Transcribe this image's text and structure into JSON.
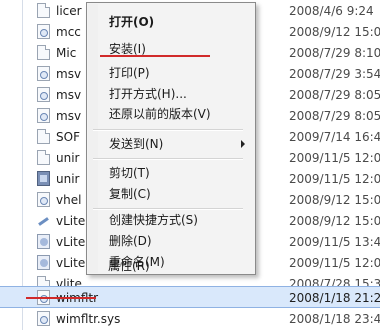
{
  "files": [
    {
      "name": "licer",
      "date": "2008/4/6 9:24",
      "icon": "blank-file-icon"
    },
    {
      "name": "mcc",
      "date": "2008/9/12 15:01",
      "icon": "settings-file-icon"
    },
    {
      "name": "Mic",
      "date": "2008/7/29 8:10",
      "icon": "blank-file-icon"
    },
    {
      "name": "msv",
      "date": "2008/7/29 3:54",
      "icon": "settings-file-icon"
    },
    {
      "name": "msv",
      "date": "2008/7/29 8:05",
      "icon": "settings-file-icon"
    },
    {
      "name": "msv",
      "date": "2008/7/29 8:05",
      "icon": "settings-file-icon"
    },
    {
      "name": "SOF",
      "date": "2009/7/14 16:49",
      "icon": "blank-file-icon"
    },
    {
      "name": "unir",
      "date": "2009/11/5 12:06",
      "icon": "blank-file-icon"
    },
    {
      "name": "unir",
      "date": "2009/11/5 12:06",
      "icon": "package-icon"
    },
    {
      "name": "vhel",
      "date": "2008/9/12 15:01",
      "icon": "settings-file-icon"
    },
    {
      "name": "vLite",
      "date": "2008/9/12 15:01",
      "icon": "wand-icon"
    },
    {
      "name": "vLite",
      "date": "2009/11/5 13:45",
      "icon": "app-icon"
    },
    {
      "name": "vLite",
      "date": "2009/11/5 12:06",
      "icon": "app-icon"
    },
    {
      "name": "vlite",
      "date": "2008/7/28 15:35",
      "icon": "blank-file-icon"
    },
    {
      "name": "wimfltr",
      "date": "2008/1/18 21:24",
      "icon": "settings-file-icon",
      "selected": true
    },
    {
      "name": "wimfltr.sys",
      "date": "2008/1/18 23:43",
      "icon": "settings-file-icon"
    }
  ],
  "context_menu": {
    "open": "打开(O)",
    "install": "安装(I)",
    "print": "打印(P)",
    "open_with": "打开方式(H)...",
    "restore": "还原以前的版本(V)",
    "send_to": "发送到(N)",
    "cut": "剪切(T)",
    "copy": "复制(C)",
    "create_shortcut": "创建快捷方式(S)",
    "delete": "删除(D)",
    "rename": "重命名(M)",
    "properties": "属性(R)"
  },
  "colors": {
    "highlight_red": "#d12a2a",
    "selection": "#d9e8fb"
  }
}
